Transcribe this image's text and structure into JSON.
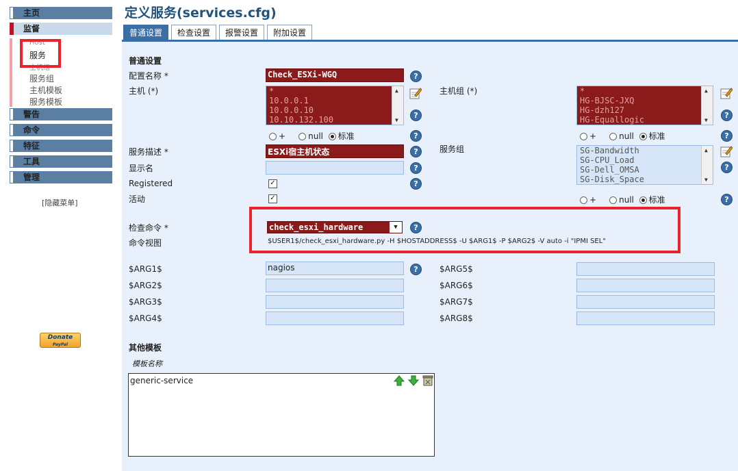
{
  "sidebar": {
    "items": [
      {
        "label": "主页",
        "active": false
      },
      {
        "label": "监督",
        "active": true
      },
      {
        "label": "警告",
        "active": false
      },
      {
        "label": "命令",
        "active": false
      },
      {
        "label": "特征",
        "active": false
      },
      {
        "label": "工具",
        "active": false
      },
      {
        "label": "管理",
        "active": false
      }
    ],
    "subitems": [
      "Host",
      "服务",
      "主机组",
      "服务组",
      "主机模板",
      "服务模板"
    ],
    "hide_menu": "[隐藏菜单]",
    "donate": "Donate",
    "donate_sub": "PayPal"
  },
  "page": {
    "title": "定义服务(services.cfg)",
    "tabs": [
      "普通设置",
      "检查设置",
      "报警设置",
      "附加设置"
    ],
    "active_tab": 0
  },
  "form": {
    "section_general": "普通设置",
    "config_name_label": "配置名称 *",
    "config_name_value": "Check_ESXi-WGQ",
    "host_label": "主机 (*)",
    "host_list": [
      "*",
      "10.0.0.1",
      "10.0.0.10",
      "10.10.132.100"
    ],
    "hostgroup_label": "主机组 (*)",
    "hostgroup_list": [
      "*",
      "HG-BJSC-JXQ",
      "HG-dzh127",
      "HG-Equallogic"
    ],
    "radio_plus": "+",
    "radio_null": "null",
    "radio_std": "标准",
    "service_desc_label": "服务描述 *",
    "service_desc_value": "ESXi宿主机状态",
    "servicegroup_label": "服务组",
    "servicegroup_list": [
      "SG-Bandwidth",
      "SG-CPU_Load",
      "SG-Dell_OMSA",
      "SG-Disk_Space"
    ],
    "display_name_label": "显示名",
    "registered_label": "Registered",
    "active_label": "活动",
    "check_cmd_label": "检查命令 *",
    "check_cmd_value": "check_esxi_hardware",
    "cmd_view_label": "命令视图",
    "cmd_view_value": "$USER1$/check_esxi_hardware.py -H $HOSTADDRESS$ -U $ARG1$ -P $ARG2$ -V auto -i \"IPMI SEL\"",
    "args": [
      {
        "label": "$ARG1$",
        "value": "nagios"
      },
      {
        "label": "$ARG2$",
        "value": ""
      },
      {
        "label": "$ARG3$",
        "value": ""
      },
      {
        "label": "$ARG4$",
        "value": ""
      },
      {
        "label": "$ARG5$",
        "value": ""
      },
      {
        "label": "$ARG6$",
        "value": ""
      },
      {
        "label": "$ARG7$",
        "value": ""
      },
      {
        "label": "$ARG8$",
        "value": ""
      }
    ],
    "other_templates_label": "其他模板",
    "template_name_label": "模板名称",
    "template_list": [
      "generic-service"
    ]
  },
  "colors": {
    "accent": "#3b6ea5",
    "highlight": "#e8232b",
    "required_field": "#8b1a1a"
  }
}
